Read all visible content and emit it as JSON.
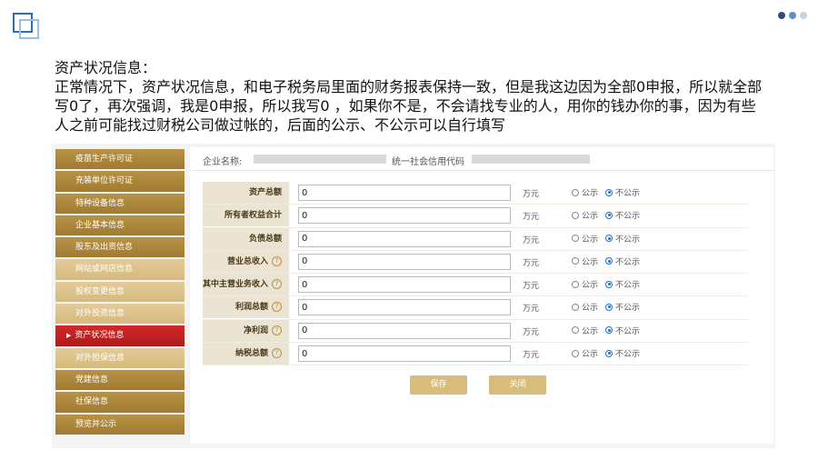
{
  "heading": {
    "title": "资产状况信息：",
    "body": "正常情况下，资产状况信息，和电子税务局里面的财务报表保持一致，但是我这边因为全部0申报，所以就全部写0了，再次强调，我是0申报，所以我写0 ，如果你不是，不会请找专业的人，用你的钱办你的事，因为有些人之前可能找过财税公司做过帐的，后面的公示、不公示可以自行填写"
  },
  "sidebar": {
    "items": [
      {
        "label": "疫苗生产许可证"
      },
      {
        "label": "充装单位许可证"
      },
      {
        "label": "特种设备信息"
      },
      {
        "label": "企业基本信息"
      },
      {
        "label": "股东及出资信息"
      },
      {
        "label": "网站或网店信息"
      },
      {
        "label": "股权变更信息"
      },
      {
        "label": "对外投资信息"
      },
      {
        "label": "资产状况信息"
      },
      {
        "label": "对外担保信息"
      },
      {
        "label": "党建信息"
      },
      {
        "label": "社保信息"
      },
      {
        "label": "预览并公示"
      }
    ]
  },
  "company": {
    "name_label": "企业名称:",
    "credit_label": "统一社会信用代码"
  },
  "form": {
    "unit": "万元",
    "public_label": "公示",
    "private_label": "不公示",
    "rows": [
      {
        "label": "资产总额",
        "value": "0",
        "help": false
      },
      {
        "label": "所有者权益合计",
        "value": "0",
        "help": false
      },
      {
        "label": "负债总额",
        "value": "0",
        "help": false
      },
      {
        "label": "营业总收入",
        "value": "0",
        "help": true
      },
      {
        "label": "其中主营业务收入",
        "value": "0",
        "help": true
      },
      {
        "label": "利润总额",
        "value": "0",
        "help": true
      },
      {
        "label": "净利润",
        "value": "0",
        "help": true
      },
      {
        "label": "纳税总额",
        "value": "0",
        "help": true
      }
    ],
    "help_glyph": "?"
  },
  "buttons": {
    "save": "保存",
    "close": "关闭"
  },
  "colors": {
    "accent": "#2f6db3",
    "sidebar": "#b89347",
    "active": "#c62222",
    "button": "#d8bc7a"
  }
}
